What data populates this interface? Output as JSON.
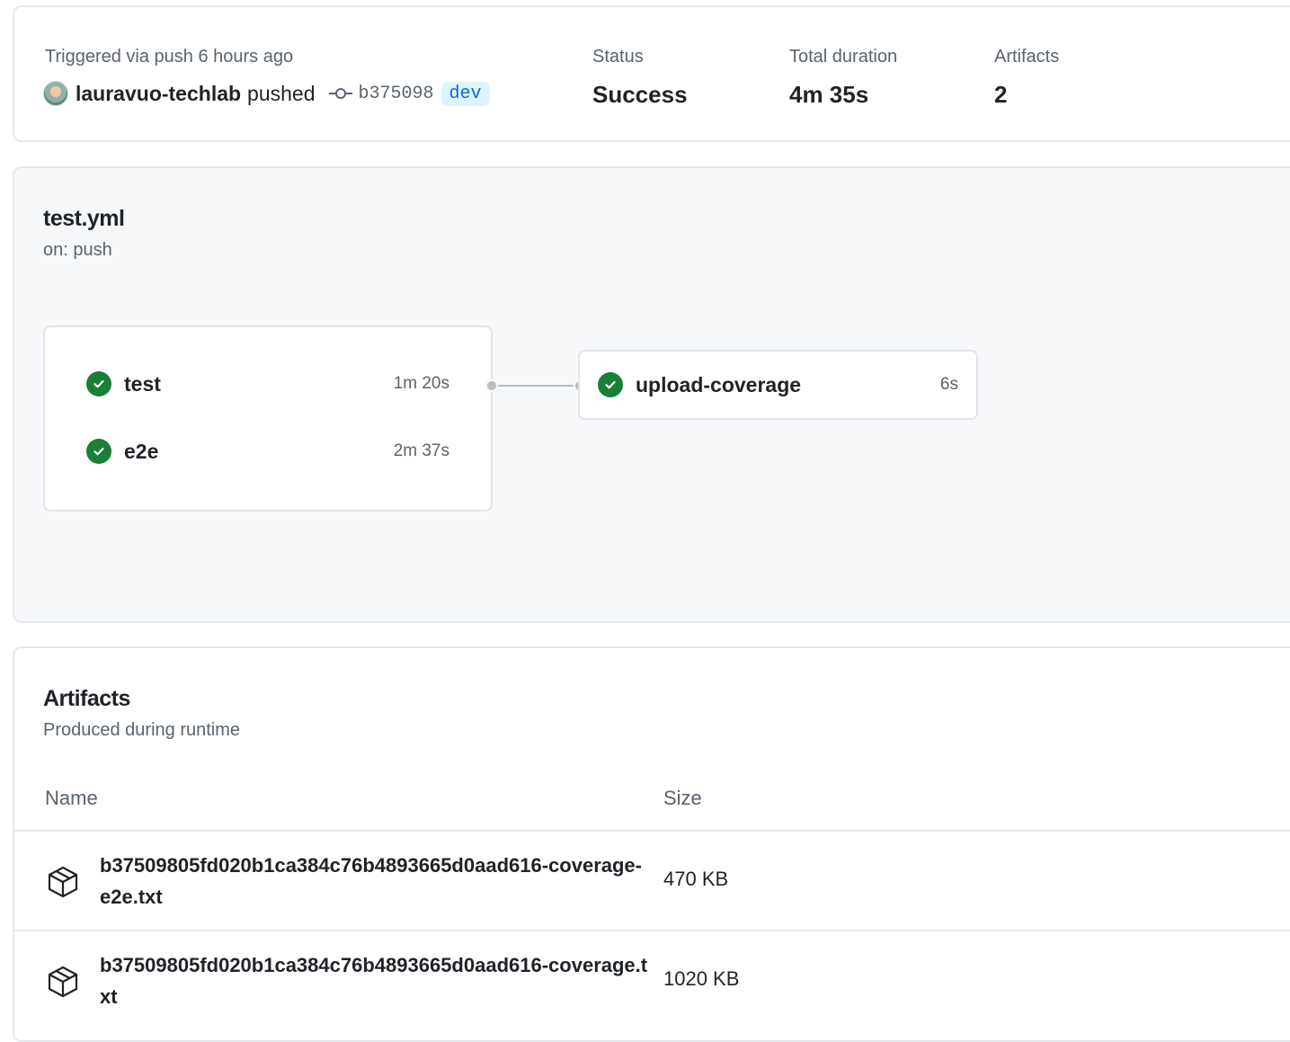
{
  "summary": {
    "triggered_label": "Triggered via push 6 hours ago",
    "user": "lauravuo-techlab",
    "action": "pushed",
    "commit_sha": "b375098",
    "branch": "dev",
    "status_label": "Status",
    "status_value": "Success",
    "duration_label": "Total duration",
    "duration_value": "4m 35s",
    "artifacts_label": "Artifacts",
    "artifacts_value": "2"
  },
  "workflow": {
    "file": "test.yml",
    "trigger": "on: push",
    "jobs": [
      {
        "name": "test",
        "duration": "1m 20s",
        "status": "success"
      },
      {
        "name": "e2e",
        "duration": "2m 37s",
        "status": "success"
      }
    ],
    "downstream": {
      "name": "upload-coverage",
      "duration": "6s",
      "status": "success"
    }
  },
  "artifacts": {
    "title": "Artifacts",
    "subtitle": "Produced during runtime",
    "col_name": "Name",
    "col_size": "Size",
    "rows": [
      {
        "name": "b37509805fd020b1ca384c76b4893665d0aad616-coverage-e2e.txt",
        "size": "470 KB",
        "icon": "package-icon"
      },
      {
        "name": "b37509805fd020b1ca384c76b4893665d0aad616-coverage.txt",
        "size": "1020 KB",
        "icon": "package-icon"
      }
    ]
  },
  "colors": {
    "success": "#1a7f37",
    "link": "#0969da",
    "muted": "#59636e",
    "border": "#e6e9ed"
  }
}
